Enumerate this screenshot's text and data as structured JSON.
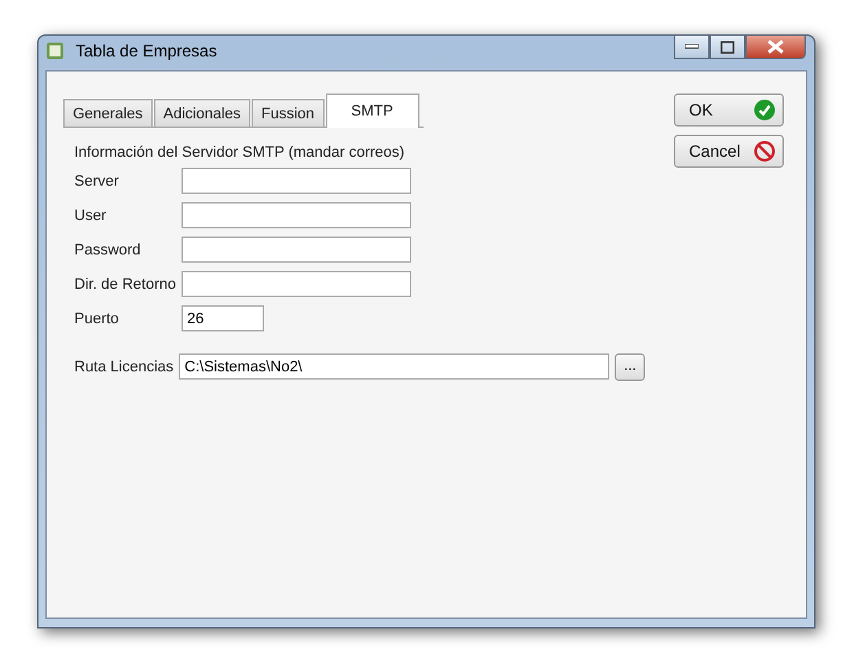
{
  "window": {
    "title": "Tabla de Empresas"
  },
  "tabs": [
    {
      "label": "Generales",
      "selected": false
    },
    {
      "label": "Adicionales",
      "selected": false
    },
    {
      "label": "Fussion",
      "selected": false
    },
    {
      "label": "SMTP",
      "selected": true
    }
  ],
  "section_title": "Información del Servidor SMTP (mandar correos)",
  "fields": [
    {
      "label": "Server",
      "kind": "wide"
    },
    {
      "label": "User",
      "kind": "wide"
    },
    {
      "label": "Password",
      "kind": "wide"
    },
    {
      "label": "Dir. de Retorno",
      "kind": "wide"
    },
    {
      "label": "Puerto",
      "value": "26",
      "kind": "narrow"
    }
  ],
  "license_path": {
    "label": "Ruta Licencias",
    "value": "C:\\Sistemas\\No2\\",
    "browse_button": "..."
  },
  "buttons": [
    {
      "label": "OK",
      "kind": "ok"
    },
    {
      "label": "Cancel",
      "kind": "cancel"
    }
  ]
}
